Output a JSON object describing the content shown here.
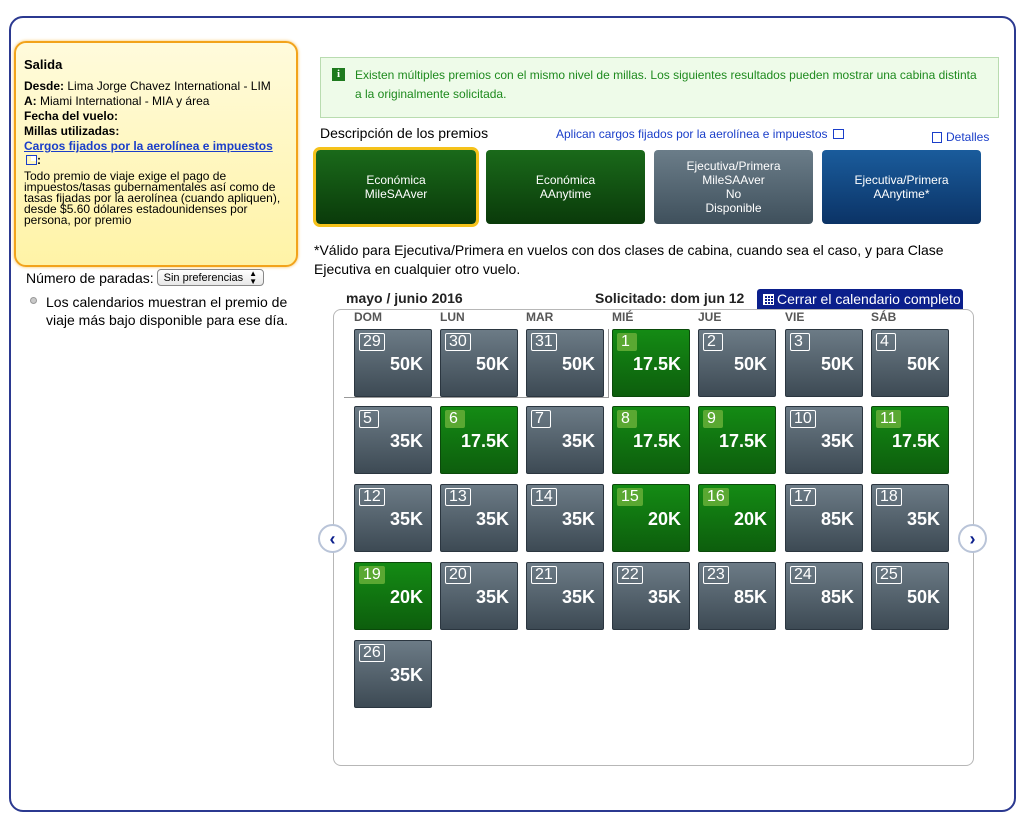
{
  "summary": {
    "title": "Salida",
    "from_label": "Desde:",
    "from_value": "Lima Jorge Chavez International - LIM",
    "to_label": "A:",
    "to_value": "Miami International - MIA y área",
    "date_label": "Fecha del vuelo:",
    "miles_label": "Millas utilizadas:",
    "fees_link": "Cargos fijados por la aerolínea e impuestos",
    "fees_suffix": ":",
    "note": "Todo premio de viaje exige el pago de impuestos/tasas gubernamentales así como de tasas fijadas por la aerolínea (cuando apliquen), desde $5.60 dólares estadounidenses por persona, por premio"
  },
  "stops": {
    "label": "Número de paradas:",
    "selected": "Sin preferencias"
  },
  "calendar_note": "Los calendarios muestran el premio de viaje más bajo disponible para ese día.",
  "banner": {
    "icon": "info-icon",
    "text": "Existen múltiples premios con el mismo nivel de millas. Los siguientes resultados pueden mostrar una cabina distinta a la originalmente solicitada."
  },
  "awards": {
    "title": "Descripción de los premios",
    "fees_link": "Aplican cargos fijados por la aerolínea e impuestos",
    "details": "Detalles",
    "tabs": [
      {
        "line1": "Económica",
        "line2": "MileSAAver",
        "line3": "",
        "line4": ""
      },
      {
        "line1": "Económica",
        "line2": "AAnytime",
        "line3": "",
        "line4": ""
      },
      {
        "line1": "Ejecutiva/Primera",
        "line2": "MileSAAver",
        "line3": "No",
        "line4": "Disponible"
      },
      {
        "line1": "Ejecutiva/Primera",
        "line2": "AAnytime*",
        "line3": "",
        "line4": ""
      }
    ]
  },
  "footnote": "*Válido para Ejecutiva/Primera en vuelos con dos clases de cabina, cuando sea el caso, y para Clase Ejecutiva en cualquier otro vuelo.",
  "calendar": {
    "month": "mayo / junio 2016",
    "requested": "Solicitado: dom jun 12",
    "close_button": "Cerrar el calendario completo",
    "days_of_week": [
      "DOM",
      "LUN",
      "MAR",
      "MIÉ",
      "JUE",
      "VIE",
      "SÁB"
    ],
    "prev_button": "‹",
    "next_button": "›",
    "weeks": [
      [
        {
          "day": "29",
          "miles": "50K",
          "type": "grey"
        },
        {
          "day": "30",
          "miles": "50K",
          "type": "grey"
        },
        {
          "day": "31",
          "miles": "50K",
          "type": "grey"
        },
        {
          "day": "1",
          "miles": "17.5K",
          "type": "green"
        },
        {
          "day": "2",
          "miles": "50K",
          "type": "grey"
        },
        {
          "day": "3",
          "miles": "50K",
          "type": "grey"
        },
        {
          "day": "4",
          "miles": "50K",
          "type": "grey"
        }
      ],
      [
        {
          "day": "5",
          "miles": "35K",
          "type": "grey"
        },
        {
          "day": "6",
          "miles": "17.5K",
          "type": "green"
        },
        {
          "day": "7",
          "miles": "35K",
          "type": "grey"
        },
        {
          "day": "8",
          "miles": "17.5K",
          "type": "green"
        },
        {
          "day": "9",
          "miles": "17.5K",
          "type": "green"
        },
        {
          "day": "10",
          "miles": "35K",
          "type": "grey"
        },
        {
          "day": "11",
          "miles": "17.5K",
          "type": "green"
        }
      ],
      [
        {
          "day": "12",
          "miles": "35K",
          "type": "grey"
        },
        {
          "day": "13",
          "miles": "35K",
          "type": "grey"
        },
        {
          "day": "14",
          "miles": "35K",
          "type": "grey"
        },
        {
          "day": "15",
          "miles": "20K",
          "type": "green"
        },
        {
          "day": "16",
          "miles": "20K",
          "type": "green"
        },
        {
          "day": "17",
          "miles": "85K",
          "type": "grey"
        },
        {
          "day": "18",
          "miles": "35K",
          "type": "grey"
        }
      ],
      [
        {
          "day": "19",
          "miles": "20K",
          "type": "green"
        },
        {
          "day": "20",
          "miles": "35K",
          "type": "grey"
        },
        {
          "day": "21",
          "miles": "35K",
          "type": "grey"
        },
        {
          "day": "22",
          "miles": "35K",
          "type": "grey"
        },
        {
          "day": "23",
          "miles": "85K",
          "type": "grey"
        },
        {
          "day": "24",
          "miles": "85K",
          "type": "grey"
        },
        {
          "day": "25",
          "miles": "50K",
          "type": "grey"
        }
      ],
      [
        {
          "day": "26",
          "miles": "35K",
          "type": "grey"
        }
      ]
    ]
  }
}
